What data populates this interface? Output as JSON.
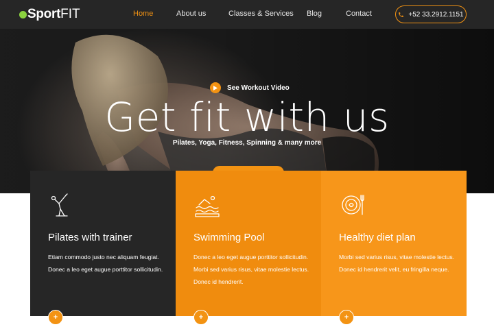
{
  "colors": {
    "accent": "#f39313",
    "dark": "#262626",
    "logo_dot": "#8bd23f"
  },
  "header": {
    "logo": {
      "part1": "Sport",
      "part2": "FIT"
    },
    "nav": [
      {
        "label": "Home",
        "active": true
      },
      {
        "label": "About us",
        "active": false
      },
      {
        "label": "Classes & Services",
        "active": false
      },
      {
        "label": "Blog",
        "active": false
      },
      {
        "label": "Contact",
        "active": false
      }
    ],
    "phone": {
      "icon": "phone-icon",
      "label": "+52 33.2912.1151"
    }
  },
  "hero": {
    "video_link": {
      "icon": "play-icon",
      "label": "See Workout Video"
    },
    "title": "Get fit with us",
    "subtitle": "Pilates, Yoga, Fitness, Spinning & many more"
  },
  "cards": [
    {
      "icon": "pilates-figure-icon",
      "title": "Pilates with trainer",
      "text": "Etiam commodo justo nec aliquam feugiat. Donec a leo eget augue porttitor sollicitudin.",
      "button": "+"
    },
    {
      "icon": "swimmer-icon",
      "title": "Swimming Pool",
      "text": "Donec a leo eget augue porttitor sollicitudin. Morbi sed varius risus, vitae molestie lectus. Donec id hendrerit.",
      "button": "+"
    },
    {
      "icon": "diet-plate-icon",
      "title": "Healthy diet plan",
      "text": "Morbi sed varius risus, vitae molestie lectus. Donec id hendrerit velit, eu fringilla neque.",
      "button": "+"
    }
  ]
}
